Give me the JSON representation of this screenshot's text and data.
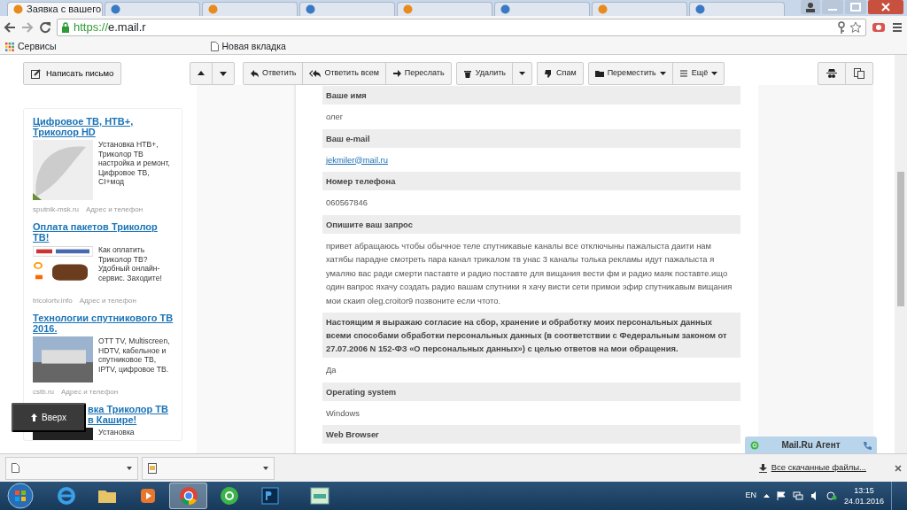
{
  "browser": {
    "tabs": [
      {
        "title": "Заявка с вашего",
        "selected": true
      },
      {
        "selected": false
      },
      {
        "selected": false
      },
      {
        "selected": false
      },
      {
        "selected": false
      },
      {
        "selected": false
      },
      {
        "selected": false
      },
      {
        "selected": false
      }
    ],
    "url": {
      "scheme": "https://",
      "host": "e.mail.r"
    },
    "bookmarks": [
      {
        "kind": "apps",
        "label": "Сервисы"
      },
      {
        "kind": "page",
        "label": "Новая вкладка"
      }
    ]
  },
  "sidebar": {
    "compose_button": "Написать письмо",
    "ads": [
      {
        "kind": "dish",
        "title": "Цифровое ТВ, НТВ+, Триколор HD",
        "text": "Установка НТВ+, Триколор ТВ настройка и ремонт, Цифровое ТВ, CI+мод",
        "domain": "sputnik-msk.ru",
        "contact": "Адрес и телефон"
      },
      {
        "kind": "wallet",
        "title": "Оплата пакетов Триколор ТВ!",
        "text": "Как оплатить Триколор ТВ? Удобный онлайн-сервис. Заходите!",
        "domain": "tricolortv.info",
        "contact": "Адрес и телефон"
      },
      {
        "kind": "photo",
        "title": "Технологии спутникового ТВ 2016.",
        "text": "OTT TV, Multiscreen, HDTV, кабельное и спутниковое ТВ, IPTV, цифровое ТВ.",
        "domain": "cstb.ru",
        "contact": "Адрес и телефон"
      },
      {
        "kind": "tv",
        "title": "вка Триколор ТВ в Кашире!",
        "text": "Установка"
      }
    ],
    "back_to_top": "Вверх"
  },
  "toolbar": {
    "groups": [
      [
        {
          "kind": "up",
          "caret": false
        },
        {
          "kind": "down",
          "caret": false
        }
      ],
      [
        {
          "kind": "reply",
          "label": "Ответить",
          "caret": false
        },
        {
          "kind": "reply-all",
          "label": "Ответить всем",
          "caret": false
        },
        {
          "kind": "forward",
          "label": "Переслать",
          "caret": false
        }
      ],
      [
        {
          "kind": "delete",
          "label": "Удалить",
          "caret": false
        },
        {
          "kind": "dropdown",
          "caret": true
        }
      ],
      [
        {
          "kind": "spam",
          "label": "Спам",
          "caret": false
        }
      ],
      [
        {
          "kind": "move",
          "label": "Переместить",
          "caret": true
        },
        {
          "kind": "more",
          "label": "Ещё",
          "caret": true
        }
      ]
    ],
    "right": [
      {
        "kind": "spy"
      },
      {
        "kind": "copy"
      }
    ]
  },
  "message": {
    "fields": [
      {
        "label": "Ваше имя",
        "kind": "text",
        "value": "олег"
      },
      {
        "label": "Ваш e-mail",
        "kind": "link",
        "value": "jekmiler@mail.ru"
      },
      {
        "label": "Номер телефона",
        "kind": "text",
        "value": "060567846"
      },
      {
        "label": "Опишите ваш запрос",
        "kind": "text",
        "value": "привет абращаюсь чтобы обычное теле спутникавые каналы все отключыны пажалыста даити нам хатябы парадне смотреть пара канал трикалом тв унас 3 каналы толька рекламы идут пажалыста я умаляю вас ради смерти паставте и радио поставте для вищания вести фм и радио маяк поставте.ищо один вапрос яхачу создать радио вашам спутники я хачу висти сети примои эфир спутникавым вищания мои скаип oleg.croitor9 позвоните если чтото."
      },
      {
        "label": "Настоящим я выражаю согласие на сбор, хранение и обработку моих персональных данных всеми способами обработки персональных данных (в соответствии с Федеральным законом от 27.07.2006 N 152-ФЗ «О персональных данных») с целью ответов на мои обращения.",
        "kind": "text",
        "value": "Да"
      },
      {
        "label": "Operating system",
        "kind": "text",
        "value": "Windows"
      },
      {
        "label": "Web Browser",
        "kind": "none"
      }
    ]
  },
  "agent": {
    "title": "Mail.Ru Агент"
  },
  "downloads": {
    "items": [
      {
        "kind": "file"
      },
      {
        "kind": "image"
      }
    ],
    "all": "Все скачанные файлы..."
  },
  "taskbar": {
    "apps": [
      {
        "kind": "ie",
        "selected": false
      },
      {
        "kind": "folder",
        "selected": false
      },
      {
        "kind": "player",
        "selected": false
      },
      {
        "kind": "chrome",
        "selected": true
      },
      {
        "kind": "agent",
        "selected": false
      },
      {
        "kind": "ps",
        "selected": false
      },
      {
        "kind": "ftp",
        "selected": false
      }
    ],
    "language": "EN",
    "time": "13:15",
    "date": "24.01.2016"
  }
}
